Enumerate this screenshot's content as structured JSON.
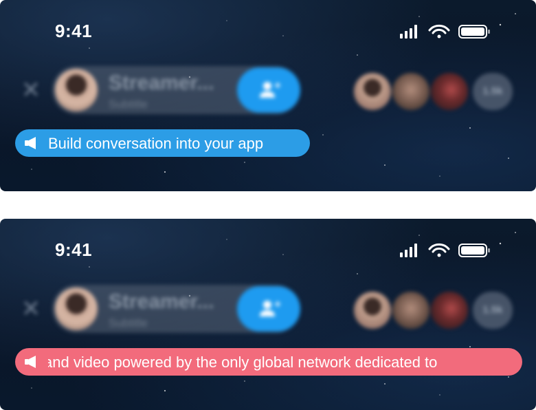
{
  "status_bar": {
    "time": "9:41"
  },
  "room_header": {
    "host_name": "Streamer...",
    "host_subtitle": "Subtitle",
    "viewer_count": "1.5k"
  },
  "announcements": [
    {
      "text": "Build conversation into your app",
      "color": "#2c9de6"
    },
    {
      "text": "and video powered by the only global network dedicated to",
      "color": "#f26b7c"
    }
  ],
  "colors": {
    "follow_button": "#1e9bf0",
    "background": "#0a1628"
  },
  "icons": [
    "close-icon",
    "add-user-icon",
    "megaphone-icon",
    "signal-icon",
    "wifi-icon",
    "battery-icon"
  ]
}
